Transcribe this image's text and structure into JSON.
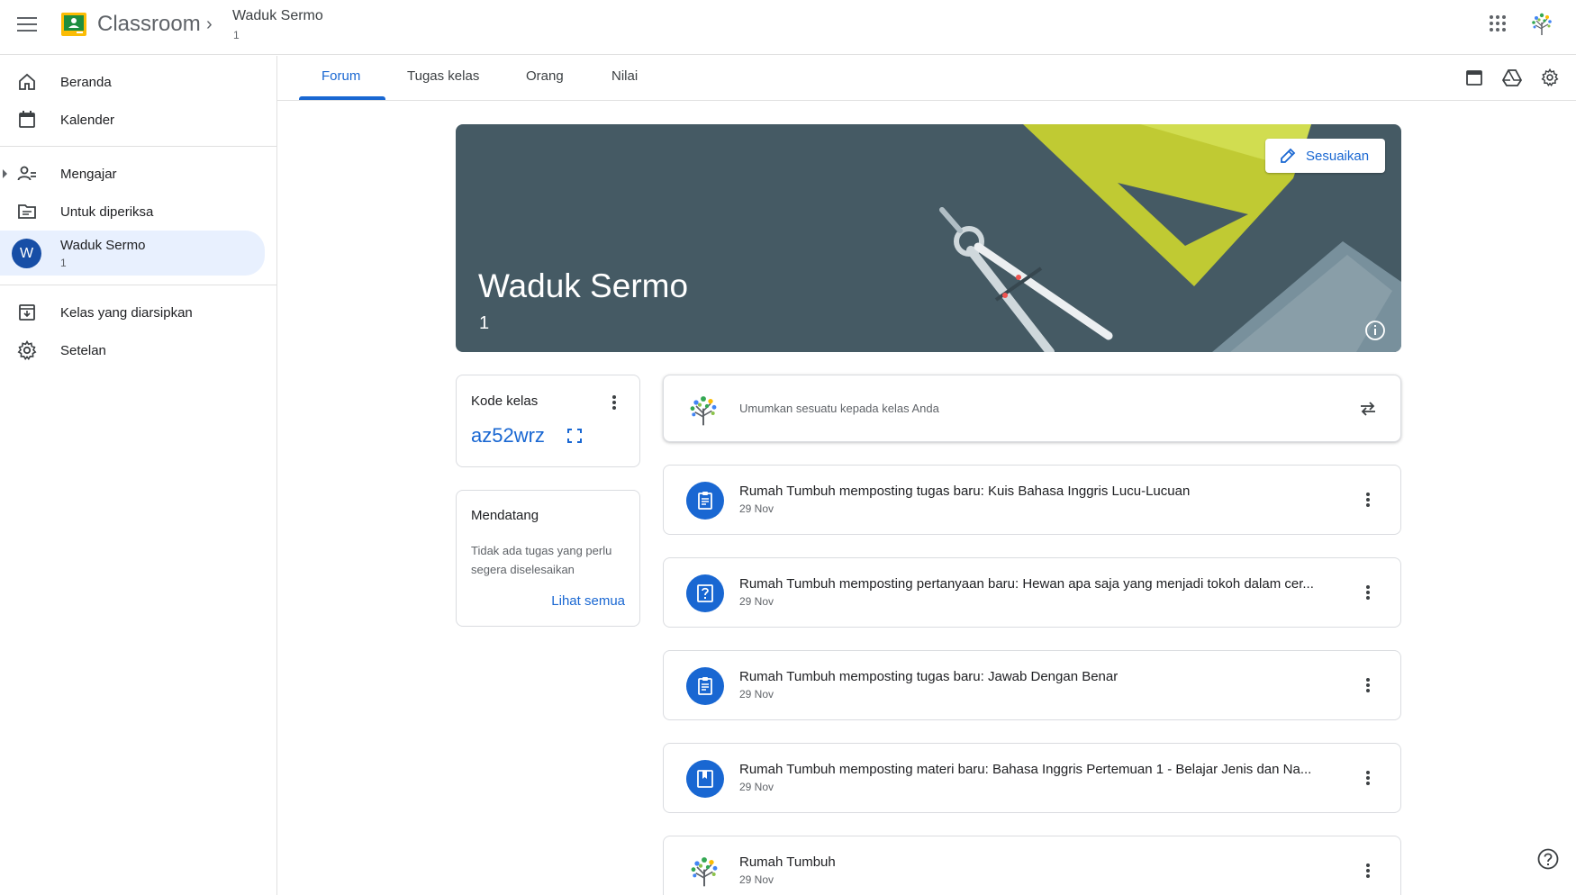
{
  "topbar": {
    "app_title": "Classroom",
    "breadcrumb_title": "Waduk Sermo",
    "breadcrumb_sub": "1"
  },
  "sidebar": {
    "items": [
      {
        "label": "Beranda",
        "icon": "home-icon"
      },
      {
        "label": "Kalender",
        "icon": "calendar-icon"
      },
      {
        "label": "Mengajar",
        "icon": "people-icon"
      },
      {
        "label": "Untuk diperiksa",
        "icon": "folder-icon"
      },
      {
        "label": "Kelas yang diarsipkan",
        "icon": "archive-icon"
      },
      {
        "label": "Setelan",
        "icon": "gear-icon"
      }
    ],
    "active_class": {
      "avatar_letter": "W",
      "name": "Waduk Sermo",
      "section": "1"
    }
  },
  "tabs": [
    {
      "label": "Forum",
      "active": true
    },
    {
      "label": "Tugas kelas",
      "active": false
    },
    {
      "label": "Orang",
      "active": false
    },
    {
      "label": "Nilai",
      "active": false
    }
  ],
  "banner": {
    "title": "Waduk Sermo",
    "subtitle": "1",
    "customize_label": "Sesuaikan",
    "bg_color": "#455a64"
  },
  "class_code": {
    "label": "Kode kelas",
    "value": "az52wrz"
  },
  "upcoming": {
    "title": "Mendatang",
    "description": "Tidak ada tugas yang perlu segera diselesaikan",
    "link": "Lihat semua"
  },
  "announce": {
    "placeholder": "Umumkan sesuatu kepada kelas Anda"
  },
  "posts": [
    {
      "type": "assignment",
      "icon": "assignment-icon",
      "title": "Rumah Tumbuh memposting tugas baru: Kuis Bahasa Inggris Lucu-Lucuan",
      "date": "29 Nov"
    },
    {
      "type": "question",
      "icon": "question-icon",
      "title": "Rumah Tumbuh memposting pertanyaan baru: Hewan apa saja yang menjadi tokoh dalam cer...",
      "date": "29 Nov"
    },
    {
      "type": "assignment",
      "icon": "assignment-icon",
      "title": "Rumah Tumbuh memposting tugas baru: Jawab Dengan Benar",
      "date": "29 Nov"
    },
    {
      "type": "material",
      "icon": "material-icon",
      "title": "Rumah Tumbuh memposting materi baru: Bahasa Inggris Pertemuan 1 - Belajar Jenis dan Na...",
      "date": "29 Nov"
    },
    {
      "type": "announcement",
      "icon": "tree-avatar-icon",
      "title": "Rumah Tumbuh",
      "date": "29 Nov"
    }
  ],
  "colors": {
    "accent": "#1967d2",
    "active_nav_bg": "#e8f0fe",
    "avatar_bg": "#174ea6"
  }
}
